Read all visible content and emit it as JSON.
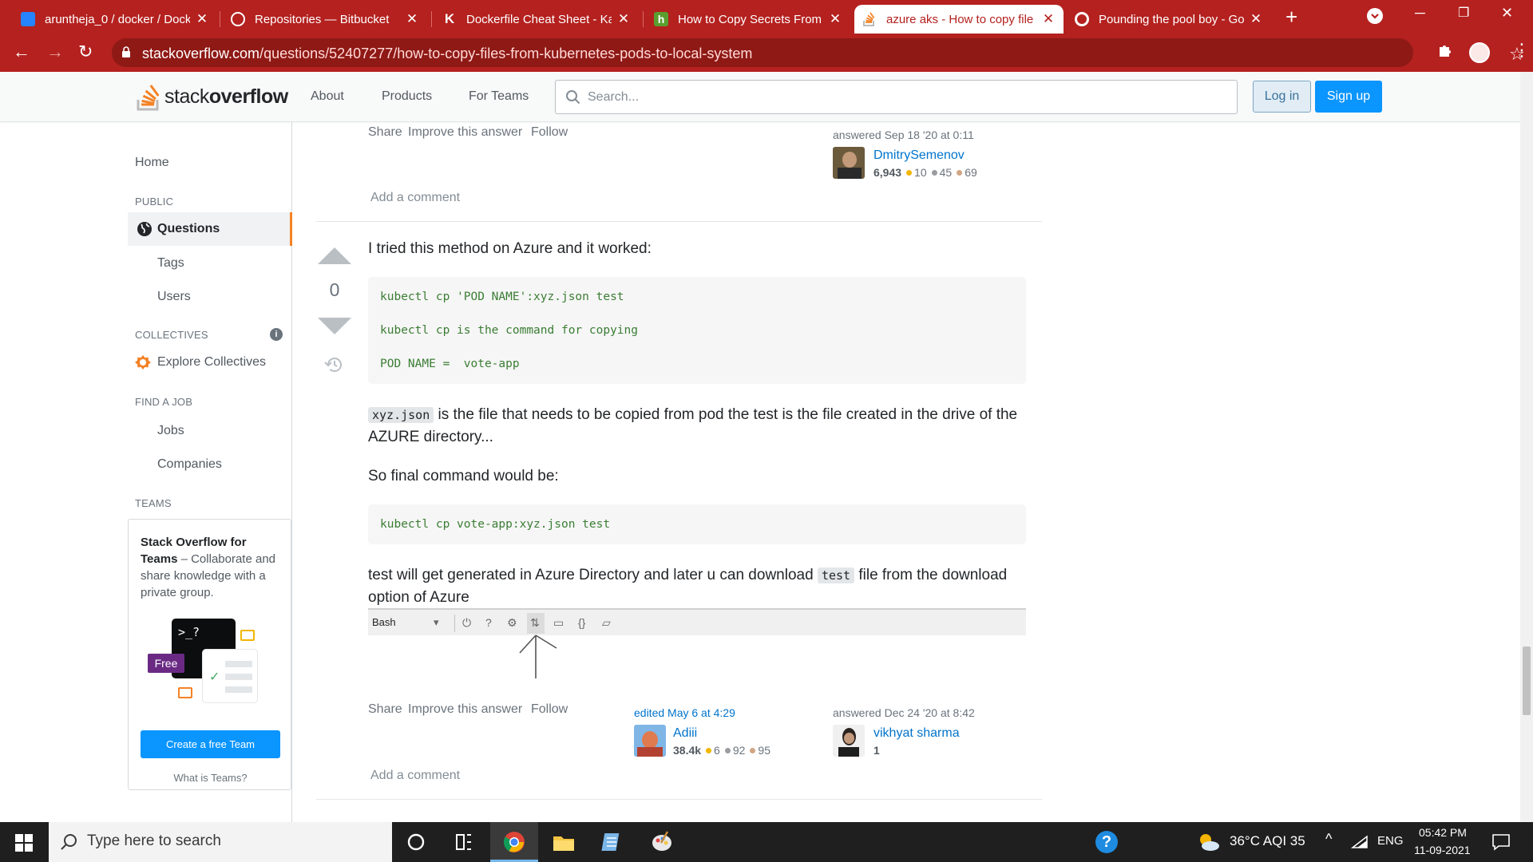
{
  "browser": {
    "tabs": [
      {
        "title": "aruntheja_0 / docker / Dock",
        "favicon_color": "#0052cc"
      },
      {
        "title": "Repositories — Bitbucket",
        "favicon_color": "#ffffff"
      },
      {
        "title": "Dockerfile Cheat Sheet - Ka",
        "favicon_color": "#ffffff"
      },
      {
        "title": "How to Copy Secrets From",
        "favicon_color": "#5a9e2f"
      },
      {
        "title": "azure aks - How to copy file",
        "favicon_color": "#f48225"
      },
      {
        "title": "Pounding the pool boy - Go",
        "favicon_color": "#ffffff"
      }
    ],
    "url_host": "stackoverflow.com",
    "url_path": "/questions/52407277/how-to-copy-files-from-kubernetes-pods-to-local-system",
    "accent_color": "#b4211f"
  },
  "header": {
    "logo_light": "stack",
    "logo_bold": "overflow",
    "nav": [
      "About",
      "Products",
      "For Teams"
    ],
    "search_placeholder": "Search...",
    "login_label": "Log in",
    "signup_label": "Sign up"
  },
  "sidebar": {
    "home": "Home",
    "public_heading": "PUBLIC",
    "questions": "Questions",
    "tags": "Tags",
    "users": "Users",
    "collectives_heading": "COLLECTIVES",
    "explore_collectives": "Explore Collectives",
    "find_job_heading": "FIND A JOB",
    "jobs": "Jobs",
    "companies": "Companies",
    "teams_heading": "TEAMS",
    "teams_title": "Stack Overflow for Teams",
    "teams_text": " – Collaborate and share knowledge with a private group.",
    "free_badge": "Free",
    "prompt_glyph": ">_?",
    "create_team": "Create a free Team",
    "what_is_teams": "What is Teams?"
  },
  "answer1": {
    "menu": [
      "Share",
      "Improve this answer",
      "Follow"
    ],
    "answered": "answered Sep 18 '20 at 0:11",
    "user": "DmitrySemenov",
    "rep": "6,943",
    "gold": "10",
    "silver": "45",
    "bronze": "69",
    "add_comment": "Add a comment"
  },
  "answer2": {
    "votes": "0",
    "intro": "I tried this method on Azure and it worked:",
    "code1": [
      "kubectl cp 'POD NAME':xyz.json test",
      "kubectl cp is the command for copying",
      "POD NAME =  vote-app"
    ],
    "inline_file": "xyz.json",
    "explain": " is the file that needs to be copied from pod the test is the file created in the drive of the AZURE directory...",
    "final_intro": "So final command would be:",
    "code2": "kubectl cp vote-app:xyz.json test",
    "outro_a": "test will get generated in Azure Directory and later u can download ",
    "inline_test": "test",
    "outro_b": " file from the download option of Azure",
    "shell_label": "Bash",
    "menu": [
      "Share",
      "Improve this answer",
      "Follow"
    ],
    "edited": "edited May 6 at 4:29",
    "editor": "Adiii",
    "editor_rep": "38.4k",
    "editor_gold": "6",
    "editor_silver": "92",
    "editor_bronze": "95",
    "answered": "answered Dec 24 '20 at 8:42",
    "user": "vikhyat sharma",
    "rep": "1",
    "add_comment": "Add a comment"
  },
  "taskbar": {
    "search_placeholder": "Type here to search",
    "weather": "36°C  AQI 35",
    "lang": "ENG",
    "time": "05:42 PM",
    "date": "11-09-2021"
  }
}
